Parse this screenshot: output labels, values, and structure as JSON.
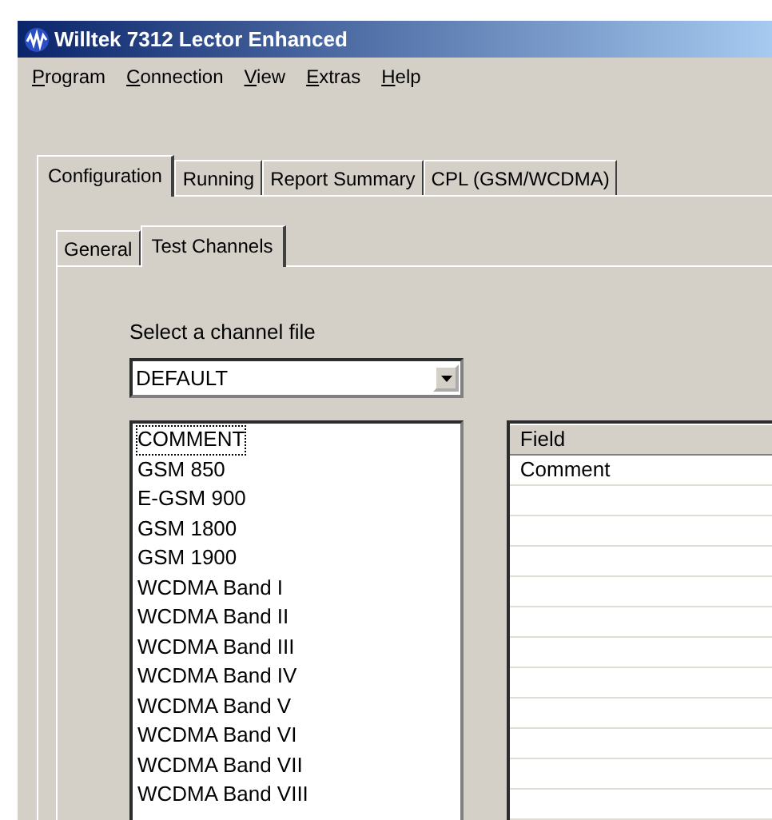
{
  "window": {
    "title": "Willtek 7312 Lector Enhanced"
  },
  "menu": [
    {
      "label": "Program"
    },
    {
      "label": "Connection"
    },
    {
      "label": "View"
    },
    {
      "label": "Extras"
    },
    {
      "label": "Help"
    }
  ],
  "tabs": [
    {
      "label": "Configuration",
      "selected": true
    },
    {
      "label": "Running",
      "selected": false
    },
    {
      "label": "Report Summary",
      "selected": false
    },
    {
      "label": "CPL (GSM/WCDMA)",
      "selected": false
    }
  ],
  "subtabs": [
    {
      "label": "General",
      "selected": false
    },
    {
      "label": "Test Channels",
      "selected": true
    }
  ],
  "channel_file": {
    "label": "Select a channel file",
    "value": "DEFAULT"
  },
  "channels": [
    {
      "label": "COMMENT",
      "selected": true
    },
    {
      "label": "GSM 850",
      "selected": false
    },
    {
      "label": "E-GSM 900",
      "selected": false
    },
    {
      "label": "GSM 1800",
      "selected": false
    },
    {
      "label": "GSM 1900",
      "selected": false
    },
    {
      "label": "WCDMA Band I",
      "selected": false
    },
    {
      "label": "WCDMA Band II",
      "selected": false
    },
    {
      "label": "WCDMA Band III",
      "selected": false
    },
    {
      "label": "WCDMA Band IV",
      "selected": false
    },
    {
      "label": "WCDMA Band V",
      "selected": false
    },
    {
      "label": "WCDMA Band VI",
      "selected": false
    },
    {
      "label": "WCDMA Band VII",
      "selected": false
    },
    {
      "label": "WCDMA Band VIII",
      "selected": false
    }
  ],
  "table": {
    "columns": [
      "Field"
    ],
    "rows": [
      [
        "Comment"
      ]
    ]
  }
}
